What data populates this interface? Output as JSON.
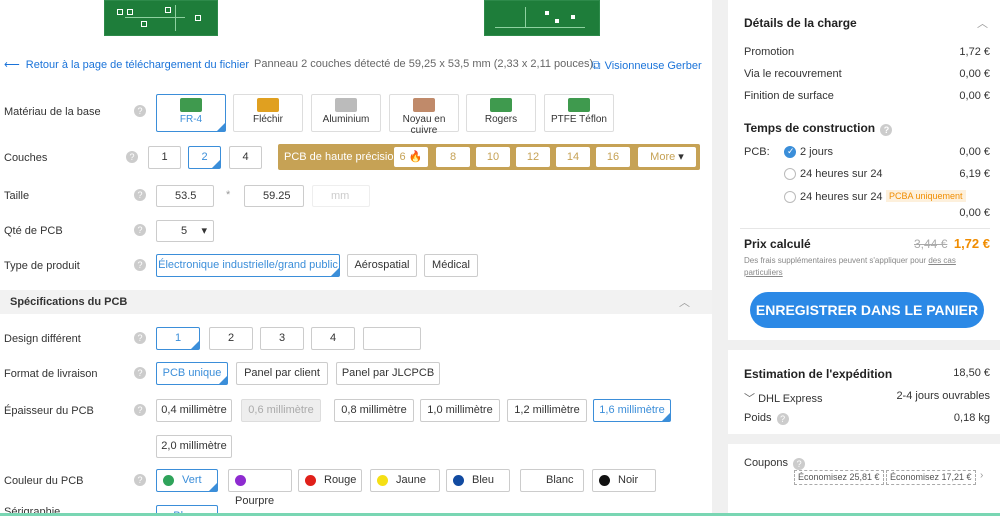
{
  "top_links": {
    "back": "Retour à la page de téléchargement du fichier",
    "detected": "Panneau 2 couches détecté de 59,25 x 53,5 mm (2,33 x 2,11 pouces).",
    "gerber": "Visionneuse Gerber"
  },
  "rows": {
    "base_material": {
      "label": "Matériau de la base",
      "options": [
        "FR-4",
        "Fléchir",
        "Aluminium",
        "Noyau en cuivre",
        "Rogers",
        "PTFE Téflon"
      ],
      "icon_colors": [
        "#3f9a4e",
        "#e0a020",
        "#bbbbbb",
        "#c08a6a",
        "#3f9a4e",
        "#3f9a4e"
      ]
    },
    "layers": {
      "label": "Couches",
      "options": [
        "1",
        "2",
        "4"
      ],
      "hp_label": "PCB de haute précision",
      "hp_options": [
        "6",
        "8",
        "10",
        "12",
        "14",
        "16"
      ],
      "more": "More"
    },
    "size": {
      "label": "Taille",
      "w": "53.5",
      "sep": "*",
      "h": "59.25",
      "unit": "mm"
    },
    "qty": {
      "label": "Qté de PCB",
      "value": "5"
    },
    "product": {
      "label": "Type de produit",
      "options": [
        "Électronique industrielle/grand public",
        "Aérospatial",
        "Médical"
      ]
    },
    "section": "Spécifications du PCB",
    "design": {
      "label": "Design différent",
      "options": [
        "1",
        "2",
        "3",
        "4"
      ]
    },
    "delivery": {
      "label": "Format de livraison",
      "options": [
        "PCB unique",
        "Panel par client",
        "Panel par JLCPCB"
      ]
    },
    "thickness": {
      "label": "Épaisseur du PCB",
      "options": [
        "0,4 millimètre",
        "0,6 millimètre",
        "0,8 millimètre",
        "1,0 millimètre",
        "1,2 millimètre",
        "1,6 millimètre",
        "2,0 millimètre"
      ]
    },
    "color": {
      "label": "Couleur du PCB",
      "options": [
        "Vert",
        "Pourpre",
        "Rouge",
        "Jaune",
        "Bleu",
        "Blanc",
        "Noir"
      ],
      "dot_colors": [
        "#2fa35a",
        "#8e2bd0",
        "#e0201a",
        "#f5df15",
        "#114aa0",
        "#ffffff",
        "#111111"
      ]
    },
    "next": {
      "label": "Sérigraphie",
      "value": "Blanc"
    }
  },
  "charges": {
    "title": "Détails de la charge",
    "items": [
      {
        "label": "Promotion",
        "value": "1,72 €"
      },
      {
        "label": "Via le recouvrement",
        "value": "0,00 €"
      },
      {
        "label": "Finition de surface",
        "value": "0,00 €"
      }
    ]
  },
  "build": {
    "title": "Temps de construction",
    "prefix": "PCB:",
    "options": [
      {
        "label": "2 jours",
        "value": "0,00 €"
      },
      {
        "label": "24 heures sur 24",
        "value": "6,19 €"
      },
      {
        "label": "24 heures sur 24",
        "badge": "PCBA uniquement",
        "value": "0,00 €"
      }
    ]
  },
  "price": {
    "title": "Prix calculé",
    "old": "3,44 €",
    "new": "1,72 €",
    "note": "Des frais supplémentaires peuvent s'appliquer pour",
    "note_link": "des cas particuliers",
    "cart": "ENREGISTRER DANS LE PANIER"
  },
  "shipping": {
    "title": "Estimation de l'expédition",
    "value": "18,50 €",
    "carrier": "DHL Express",
    "time": "2-4 jours ouvrables",
    "weight_label": "Poids",
    "weight": "0,18 kg"
  },
  "coupons": {
    "label": "Coupons",
    "items": [
      "Économisez 25,81 €",
      "Économisez 17,21 €"
    ]
  },
  "colors": {
    "accent": "#3b8ed9",
    "cart": "#2b89e6",
    "price": "#f08c00",
    "gold": "#c6a255"
  }
}
